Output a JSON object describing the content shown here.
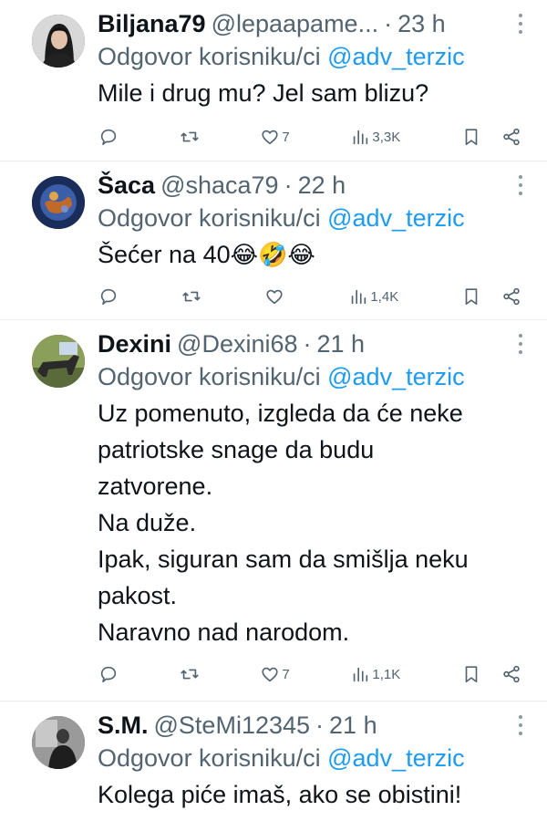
{
  "reply_prefix": "Odgovor korisniku/ci",
  "reply_to": "@adv_terzic",
  "tweets": [
    {
      "name": "Biljana79",
      "handle": "@lepaapame...",
      "time": "23 h",
      "text_lines": [
        "Mile i drug mu? Jel sam blizu?"
      ],
      "likes": "7",
      "views": "3,3K"
    },
    {
      "name": "Šaca",
      "handle": "@shaca79",
      "time": "22 h",
      "text_lines": [
        "Šećer na 40"
      ],
      "emojis": "😂🤣😂",
      "likes": "",
      "views": "1,4K"
    },
    {
      "name": "Dexini",
      "handle": "@Dexini68",
      "time": "21 h",
      "text_lines": [
        "Uz pomenuto, izgleda da će neke",
        "patriotske snage da budu",
        "zatvorene.",
        "Na duže.",
        "Ipak, siguran sam da smišlja neku",
        "pakost.",
        "Naravno nad narodom."
      ],
      "likes": "7",
      "views": "1,1K"
    },
    {
      "name": "S.M.",
      "handle": "@SteMi12345",
      "time": "21 h",
      "text_lines": [
        "Kolega piće imaš, ako se obistini!"
      ]
    }
  ],
  "colors": {
    "text": "#0f1419",
    "secondary": "#536471",
    "mention": "#1d9bf0",
    "divider": "#e6ecf0"
  },
  "icons": [
    "reply-icon",
    "retweet-icon",
    "like-icon",
    "views-icon",
    "bookmark-icon",
    "share-icon",
    "more-icon"
  ]
}
